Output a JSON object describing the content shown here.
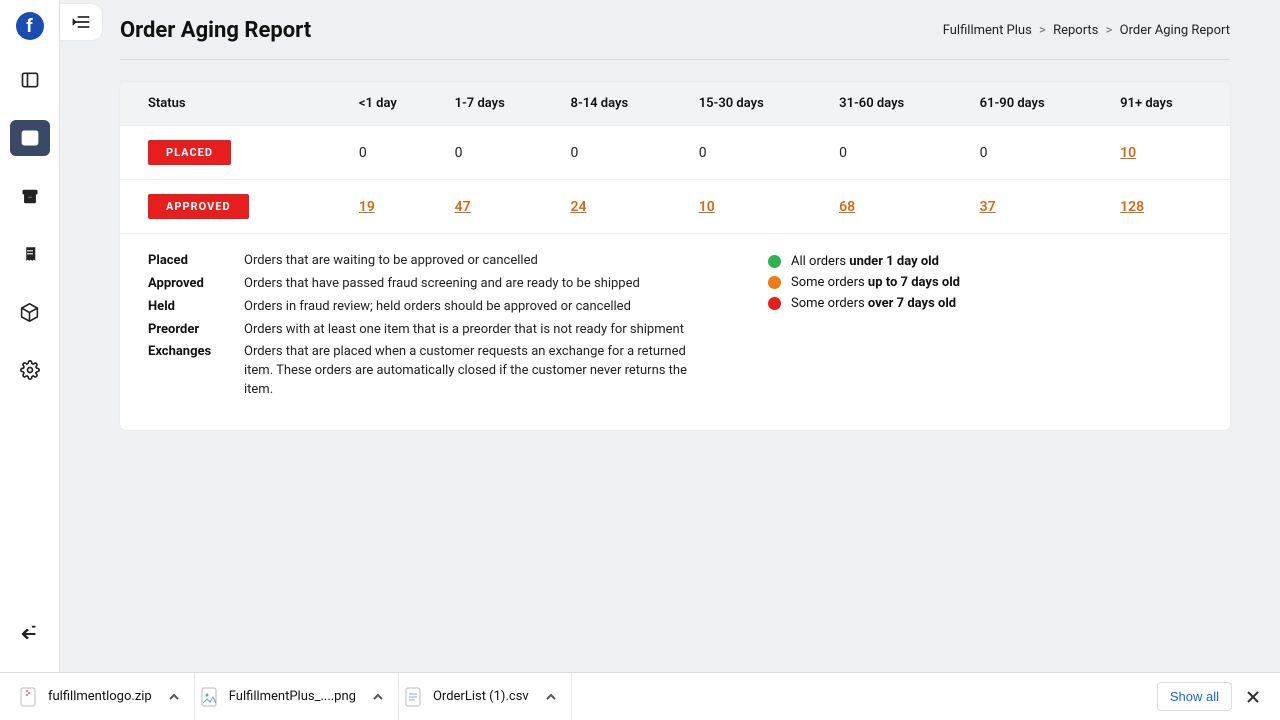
{
  "logo_letter": "f",
  "page": {
    "title": "Order Aging Report",
    "breadcrumb": {
      "a": "Fulfillment Plus",
      "b": "Reports",
      "c": "Order Aging Report"
    }
  },
  "table": {
    "headers": [
      "Status",
      "<1 day",
      "1-7 days",
      "8-14 days",
      "15-30 days",
      "31-60 days",
      "61-90 days",
      "91+ days"
    ],
    "rows": [
      {
        "status": "PLACED",
        "cells": [
          {
            "v": "0",
            "link": false
          },
          {
            "v": "0",
            "link": false
          },
          {
            "v": "0",
            "link": false
          },
          {
            "v": "0",
            "link": false
          },
          {
            "v": "0",
            "link": false
          },
          {
            "v": "0",
            "link": false
          },
          {
            "v": "10",
            "link": true
          }
        ]
      },
      {
        "status": "APPROVED",
        "cells": [
          {
            "v": "19",
            "link": true
          },
          {
            "v": "47",
            "link": true
          },
          {
            "v": "24",
            "link": true
          },
          {
            "v": "10",
            "link": true
          },
          {
            "v": "68",
            "link": true
          },
          {
            "v": "37",
            "link": true
          },
          {
            "v": "128",
            "link": true
          }
        ]
      }
    ]
  },
  "definitions": [
    {
      "term": "Placed",
      "desc": "Orders that are waiting to be approved or cancelled"
    },
    {
      "term": "Approved",
      "desc": "Orders that have passed fraud screening and are ready to be shipped"
    },
    {
      "term": "Held",
      "desc": "Orders in fraud review; held orders should be approved or cancelled"
    },
    {
      "term": "Preorder",
      "desc": "Orders with at least one item that is a preorder that is not ready for shipment"
    },
    {
      "term": "Exchanges",
      "desc": "Orders that are placed when a customer requests an exchange for a returned item. These orders are automatically closed if the customer never returns the item."
    }
  ],
  "legend": [
    {
      "color": "#2eb24c",
      "pre": "All orders ",
      "bold": "under 1 day old"
    },
    {
      "color": "#f07a14",
      "pre": "Some orders ",
      "bold": "up to 7 days old"
    },
    {
      "color": "#e61e1e",
      "pre": "Some orders ",
      "bold": "over 7 days old"
    }
  ],
  "downloads": {
    "items": [
      {
        "name": "fulfillmentlogo.zip",
        "icon": "zip"
      },
      {
        "name": "FulfillmentPlus_....png",
        "icon": "img"
      },
      {
        "name": "OrderList (1).csv",
        "icon": "doc"
      }
    ],
    "show_all": "Show all"
  }
}
